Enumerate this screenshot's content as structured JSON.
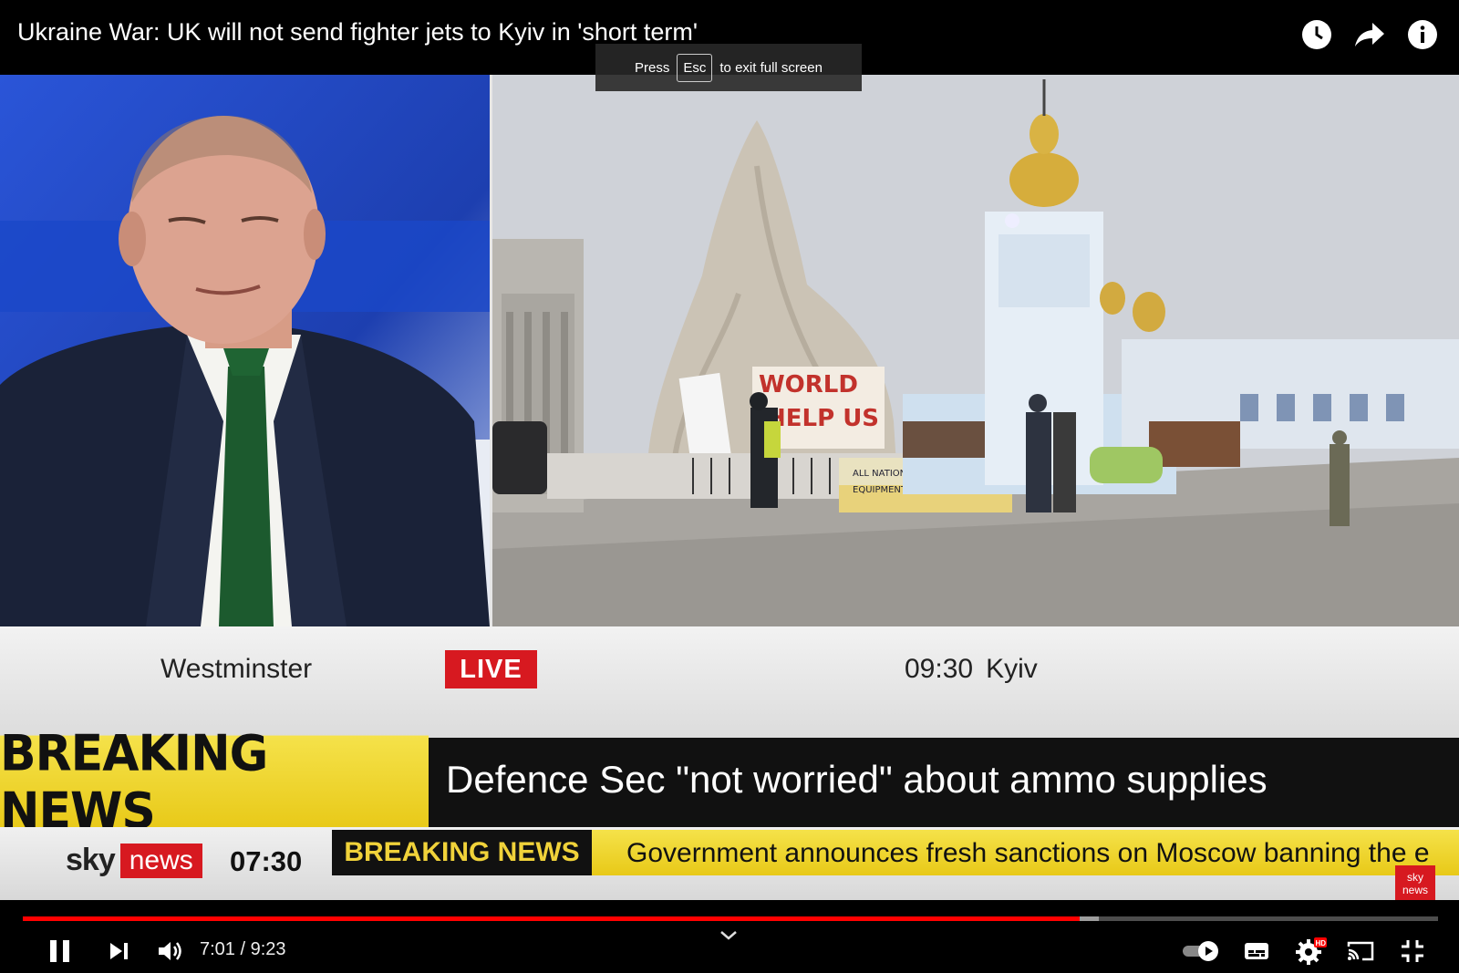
{
  "player": {
    "title": "Ukraine War: UK will not send fighter jets to Kyiv in 'short term'",
    "fullscreen_toast": {
      "press": "Press",
      "key": "Esc",
      "suffix": "to exit full screen"
    },
    "icons": [
      "clock-icon",
      "share-icon",
      "info-icon"
    ],
    "controls": {
      "current_time": "7:01 / 9:23",
      "progress_played": 0.747,
      "progress_buffered": 0.76,
      "icons": [
        "pause-icon",
        "next-icon",
        "volume-icon",
        "chevron-down-icon",
        "autoplay-toggle",
        "subtitles-icon",
        "settings-icon",
        "cast-icon",
        "exit-fullscreen-icon"
      ],
      "hd_badge": "HD"
    }
  },
  "broadcast": {
    "location_left": "Westminster",
    "live_label": "LIVE",
    "time_right": "09:30",
    "location_right": "Kyiv",
    "breaking_label": "BREAKING NEWS",
    "headline": "Defence Sec \"not worried\" about ammo supplies",
    "sky": "sky",
    "news": "news",
    "ticker_time": "07:30",
    "ticker_label": "BREAKING NEWS",
    "ticker_text": "Government announces fresh sanctions on Moscow banning the e",
    "corner_logo": {
      "sky": "sky",
      "news": "news"
    },
    "scene_signs": {
      "banner": "WORLD HELP US",
      "sign": "ALL NATIONS WE NEED YOUR MILITARY EQUIPMENT AND PERSONNEL PLEASE"
    }
  },
  "colors": {
    "sky_red": "#d71920",
    "yellow": "#f0d23a",
    "progress_red": "#ff0000"
  }
}
